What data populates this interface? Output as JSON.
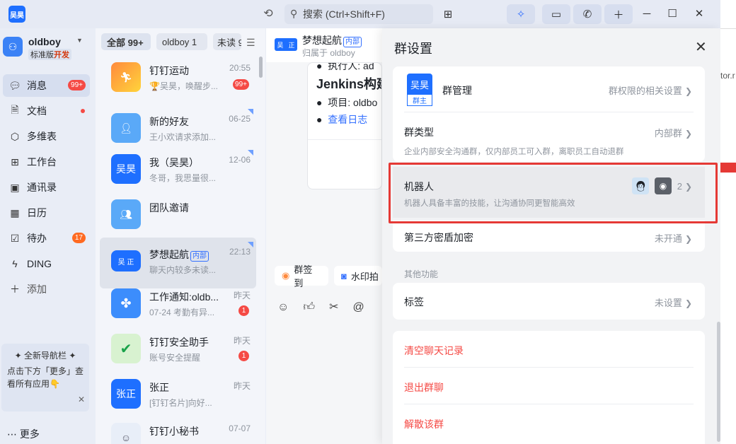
{
  "app": {
    "logo_text": "吴昊"
  },
  "titlebar": {
    "search_placeholder": "搜索 (Ctrl+Shift+F)"
  },
  "user": {
    "name": "oldboy",
    "plan": "标准版",
    "plan_tag": "开发"
  },
  "nav": [
    {
      "label": "消息",
      "icon": "message-icon",
      "badge": "99+"
    },
    {
      "label": "文档",
      "icon": "doc-icon",
      "dot": true
    },
    {
      "label": "多维表",
      "icon": "table-icon"
    },
    {
      "label": "工作台",
      "icon": "workspace-icon"
    },
    {
      "label": "通讯录",
      "icon": "contacts-icon"
    },
    {
      "label": "日历",
      "icon": "calendar-icon"
    },
    {
      "label": "待办",
      "icon": "todo-icon",
      "badge": "17"
    },
    {
      "label": "DING",
      "icon": "ding-icon"
    },
    {
      "label": "添加",
      "icon": "plus-icon"
    }
  ],
  "promo": {
    "title": "全新导航栏",
    "text": "点击下方「更多」查看所有应用👇"
  },
  "more_label": "更多",
  "filters": {
    "all": "全部 99+",
    "oldboy": "oldboy 1",
    "unread": "未读 9"
  },
  "chats": [
    {
      "name": "钉钉运动",
      "preview": "🏆吴昊，唤醒步...",
      "time": "20:55",
      "badge": "99+"
    },
    {
      "name": "新的好友",
      "preview": "王小欢请求添加...",
      "time": "06-25"
    },
    {
      "name": "我（吴昊）",
      "preview": "冬哥，我思量很...",
      "time": "12-06",
      "avatar_text": "吴昊"
    },
    {
      "name": "团队邀请",
      "preview": "",
      "time": ""
    },
    {
      "name": "梦想起航",
      "tag": "内部",
      "preview": "聊天内较多未读...",
      "time": "22:13"
    },
    {
      "name": "工作通知:oldb...",
      "preview": "07-24 考勤有异...",
      "time": "昨天",
      "badge": "1"
    },
    {
      "name": "钉钉安全助手",
      "preview": "账号安全提醒",
      "time": "昨天",
      "badge": "1"
    },
    {
      "name": "张正",
      "preview": "[钉钉名片]向好...",
      "time": "昨天",
      "avatar_text": "张正"
    },
    {
      "name": "钉钉小秘书",
      "preview": "",
      "time": "07-07"
    }
  ],
  "chat": {
    "title": "梦想起航",
    "tag": "内部",
    "subtitle": "归属于 oldboy",
    "group_icon_left": "吴",
    "group_icon_right": "正",
    "msg": {
      "line1": "执行人: ad",
      "heading": "Jenkins构建",
      "item": "项目: oldbo",
      "link": "查看日志"
    },
    "quick": [
      "群签到",
      "水印拍"
    ]
  },
  "panel": {
    "title": "群设置",
    "manage": {
      "label": "群管理",
      "value": "群权限的相关设置",
      "avatar": "吴昊",
      "avatar_sub": "群主"
    },
    "type": {
      "label": "群类型",
      "value": "内部群",
      "desc": "企业内部安全沟通群，仅内部员工可入群，离职员工自动退群"
    },
    "robot": {
      "label": "机器人",
      "count": "2",
      "desc": "机器人具备丰富的技能，让沟通协同更智能高效"
    },
    "encrypt": {
      "label": "第三方密盾加密",
      "value": "未开通"
    },
    "other_label": "其他功能",
    "tags": {
      "label": "标签",
      "value": "未设置"
    },
    "danger": [
      "清空聊天记录",
      "退出群聊",
      "解散该群"
    ]
  },
  "right_fragment": "tor.r"
}
